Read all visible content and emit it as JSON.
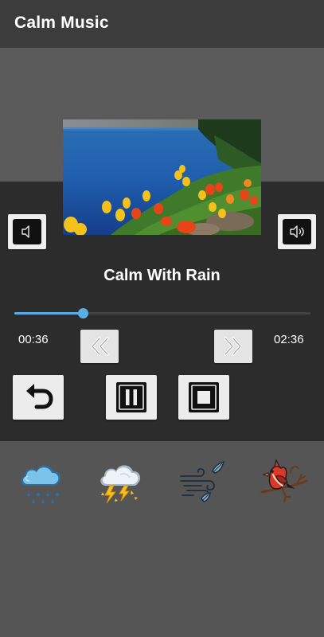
{
  "app": {
    "title": "Calm Music"
  },
  "player": {
    "track_title": "Calm With Rain",
    "current_time": "00:36",
    "total_time": "02:36",
    "progress": 0.23,
    "accent_color": "#5aaee8"
  },
  "controls": {
    "volume_down_icon": "volume-down-icon",
    "volume_up_icon": "volume-up-icon",
    "rewind_icon": "rewind-icon",
    "fast_forward_icon": "fast-forward-icon",
    "replay_icon": "replay-icon",
    "pause_icon": "pause-icon",
    "stop_icon": "stop-icon"
  },
  "sounds": [
    {
      "icon": "rain-cloud-icon"
    },
    {
      "icon": "thunderstorm-icon"
    },
    {
      "icon": "wind-icon"
    },
    {
      "icon": "bird-icon"
    }
  ]
}
